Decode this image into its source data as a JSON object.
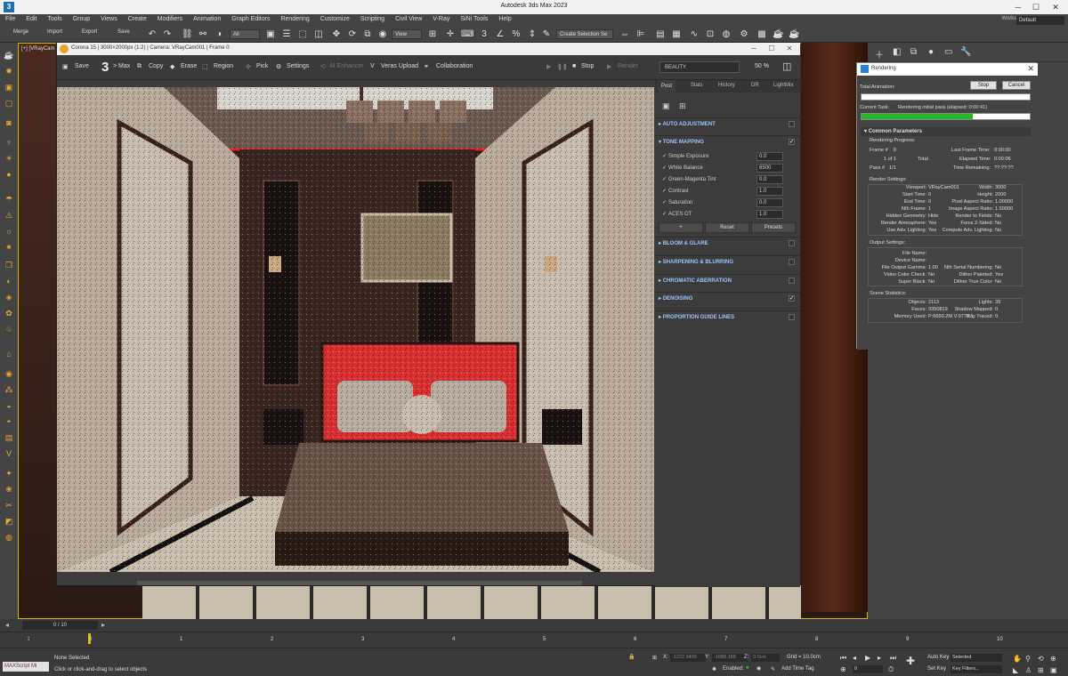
{
  "app": {
    "title": "Autodesk 3ds Max 2023",
    "logo": "3",
    "menu": [
      "File",
      "Edit",
      "Tools",
      "Group",
      "Views",
      "Create",
      "Modifiers",
      "Animation",
      "Graph Editors",
      "Rendering",
      "Customize",
      "Scripting",
      "Civil View",
      "V-Ray",
      "SiNi Tools",
      "Help"
    ],
    "workspaces_label": "Workspaces:",
    "workspaces_value": "Default",
    "toolbar": {
      "merge": "Merge",
      "import": "Import",
      "export": "Export",
      "save": "Save",
      "filter": "All",
      "view": "View",
      "selection_set": "Create Selection Se"
    },
    "viewport_label": "[+] [VRayCam"
  },
  "corona": {
    "title": "Corona 15 | 3000×2000px (1:2) | Camera: VRayCam001 | Frame 0",
    "toolbar": {
      "save": "Save",
      "max_num": "3",
      "max": "> Max",
      "copy": "Copy",
      "erase": "Erase",
      "region": "Region",
      "pick": "Pick",
      "settings": "Settings",
      "ai_enhancer": "AI Enhancer",
      "veras_upload": "Veras Upload",
      "collaboration": "Collaboration",
      "stop": "Stop",
      "render": "Render",
      "beauty": "BEAUTY",
      "zoom": "50 %"
    },
    "tabs": [
      "Post",
      "Stats",
      "History",
      "DR",
      "LightMix"
    ],
    "sections": {
      "auto_adjustment": "AUTO ADJUSTMENT",
      "tone_mapping": "TONE MAPPING",
      "bloom_glare": "BLOOM & GLARE",
      "sharpening": "SHARPENING & BLURRING",
      "chromatic": "CHROMATIC ABERRATION",
      "denoising": "DENOISING",
      "proportion": "PROPORTION GUIDE LINES"
    },
    "tone_rows": [
      {
        "label": "Simple Exposure",
        "value": "0.0"
      },
      {
        "label": "White Balance",
        "value": "6500"
      },
      {
        "label": "Green-Magenta Tint",
        "value": "0.0"
      },
      {
        "label": "Contrast",
        "value": "1.0"
      },
      {
        "label": "Saturation",
        "value": "0.0"
      },
      {
        "label": "ACES OT",
        "value": "1.0"
      }
    ],
    "buttons": {
      "add": "+",
      "reset": "Reset",
      "presets": "Presets"
    },
    "check": "✓"
  },
  "rendering": {
    "title": "Rendering",
    "total_animation": "Total Animation:",
    "stop": "Stop",
    "cancel": "Cancel",
    "current_task_label": "Current Task:",
    "current_task": "Rendering initial pass (elapsed: 0:00:41)",
    "progress": 0.66,
    "common_params": "Common Parameters",
    "rendering_progress": "Rendering Progress:",
    "frame_label": "Frame #",
    "frame": "0",
    "of_label": "1 of 1",
    "total": "Total",
    "pass_label": "Pass #",
    "pass": "1/1",
    "last_frame_time": "Last Frame Time:",
    "last_frame_time_v": "0:00:00",
    "elapsed_time": "Elapsed Time:",
    "elapsed_time_v": "0:00:06",
    "time_remaining": "Time Remaining:",
    "time_remaining_v": "??:??:??",
    "render_settings": "Render Settings:",
    "rs_left": [
      [
        "Viewport:",
        "VRayCam001"
      ],
      [
        "Start Time:",
        "0"
      ],
      [
        "End Time:",
        "0"
      ],
      [
        "Nth Frame:",
        "1"
      ],
      [
        "Hidden Geometry:",
        "Hide"
      ],
      [
        "Render Atmosphere:",
        "Yes"
      ],
      [
        "Use Adv. Lighting:",
        "Yes"
      ]
    ],
    "rs_right": [
      [
        "Width:",
        "3000"
      ],
      [
        "Height:",
        "2000"
      ],
      [
        "Pixel Aspect Ratio:",
        "1.00000"
      ],
      [
        "Image Aspect Ratio:",
        "1.50000"
      ],
      [
        "Render to Fields:",
        "No"
      ],
      [
        "Force 2-Sided:",
        "No"
      ],
      [
        "Compute Adv. Lighting:",
        "No"
      ]
    ],
    "output_settings": "Output Settings:",
    "os_left": [
      [
        "File Name:",
        ""
      ],
      [
        "Device Name:",
        ""
      ],
      [
        "File Output Gamma:",
        "1.00"
      ],
      [
        "Video Color Check:",
        "No"
      ],
      [
        "Super Black:",
        "No"
      ]
    ],
    "os_right": [
      [
        "",
        ""
      ],
      [
        "",
        ""
      ],
      [
        "Nth Serial Numbering:",
        "No"
      ],
      [
        "Dither Paletted:",
        "Yes"
      ],
      [
        "Dither True Color:",
        "No"
      ]
    ],
    "scene_stats": "Scene Statistics:",
    "ss_left": [
      [
        "Objects:",
        "2113"
      ],
      [
        "Faces:",
        "9350819"
      ],
      [
        "Memory Used:",
        "P:6650.2M V:9778.1"
      ]
    ],
    "ss_right": [
      [
        "Lights:",
        "39"
      ],
      [
        "Shadow Mapped:",
        "0"
      ],
      [
        "Ray Traced:",
        "0"
      ]
    ]
  },
  "timeline": {
    "frame": "0 / 10",
    "ticks": [
      "0",
      "1",
      "2",
      "3",
      "4",
      "5",
      "6",
      "7",
      "8",
      "9",
      "10"
    ]
  },
  "status": {
    "maxscript": "MAXScript Mi",
    "none_selected": "None Selected",
    "hint": "Click or click-and-drag to select objects",
    "x_label": "X:",
    "x": "-1222.9459",
    "y_label": "Y:",
    "y": "-1088.188",
    "z_label": "Z:",
    "z": "0.0cm",
    "grid": "Grid = 10.0cm",
    "enabled": "Enabled:",
    "add_time_tag": "Add Time Tag",
    "auto_key": "Auto Key",
    "set_key": "Set Key",
    "selected": "Selected",
    "key_filters": "Key Filters...",
    "frame": "0"
  }
}
